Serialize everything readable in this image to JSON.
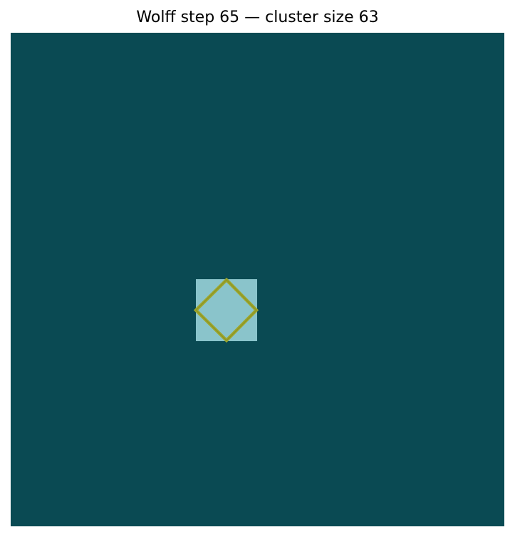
{
  "title": "Wolff step 65 — cluster size 63",
  "lattice": {
    "background_spin_color": "#0a4a53",
    "cluster_spin_color": "#8ac4cb",
    "cluster_outline_color": "#9ea62a"
  }
}
